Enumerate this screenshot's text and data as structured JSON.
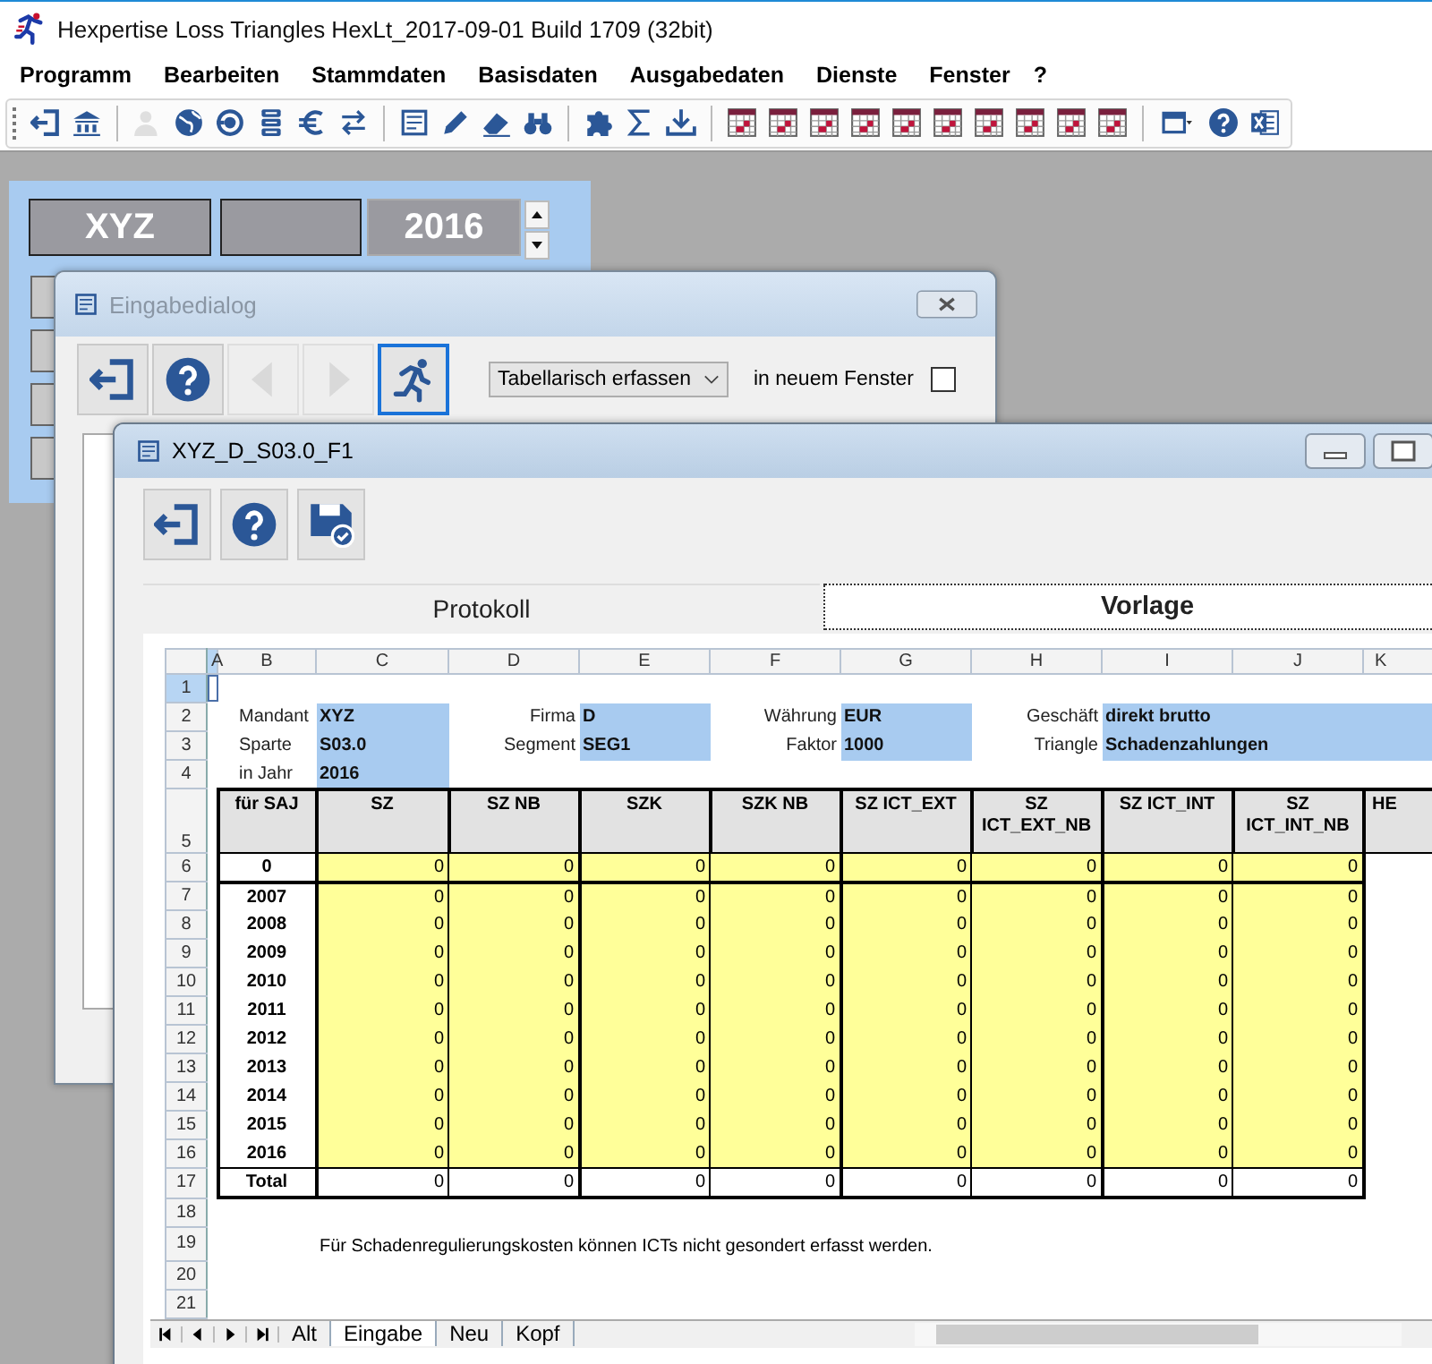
{
  "window": {
    "title": "Hexpertise Loss Triangles HexLt_2017-09-01 Build 1709 (32bit)"
  },
  "menu": [
    "Programm",
    "Bearbeiten",
    "Stammdaten",
    "Basisdaten",
    "Ausgabedaten",
    "Dienste",
    "Fenster",
    "?"
  ],
  "toolbar": [
    {
      "kind": "exit",
      "disabled": false
    },
    {
      "kind": "bank",
      "disabled": false
    },
    {
      "kind": "sep"
    },
    {
      "kind": "user",
      "disabled": true
    },
    {
      "kind": "globe",
      "disabled": false
    },
    {
      "kind": "target",
      "disabled": false
    },
    {
      "kind": "server",
      "disabled": false
    },
    {
      "kind": "euro",
      "disabled": false
    },
    {
      "kind": "exchange",
      "disabled": false
    },
    {
      "kind": "sep"
    },
    {
      "kind": "form",
      "disabled": false
    },
    {
      "kind": "pencil",
      "disabled": false
    },
    {
      "kind": "eraser",
      "disabled": false
    },
    {
      "kind": "binoculars",
      "disabled": false
    },
    {
      "kind": "sep"
    },
    {
      "kind": "puzzle",
      "disabled": false
    },
    {
      "kind": "sigma",
      "disabled": false
    },
    {
      "kind": "download",
      "disabled": false
    },
    {
      "kind": "sep"
    },
    {
      "kind": "grid",
      "disabled": false
    },
    {
      "kind": "grid",
      "disabled": false
    },
    {
      "kind": "grid",
      "disabled": false
    },
    {
      "kind": "grid",
      "disabled": false
    },
    {
      "kind": "grid",
      "disabled": false
    },
    {
      "kind": "grid",
      "disabled": false
    },
    {
      "kind": "grid",
      "disabled": false
    },
    {
      "kind": "grid",
      "disabled": false
    },
    {
      "kind": "grid",
      "disabled": false
    },
    {
      "kind": "grid",
      "disabled": false
    },
    {
      "kind": "sep"
    },
    {
      "kind": "windows",
      "disabled": false
    },
    {
      "kind": "help",
      "disabled": false
    },
    {
      "kind": "excel",
      "disabled": false
    }
  ],
  "panel": {
    "client": "XYZ",
    "year": "2016"
  },
  "dialog": {
    "title": "Eingabedialog",
    "buttons": [
      {
        "kind": "exit",
        "disabled": false,
        "focused": false
      },
      {
        "kind": "help",
        "disabled": false,
        "focused": false
      },
      {
        "kind": "prev",
        "disabled": true,
        "focused": false
      },
      {
        "kind": "next",
        "disabled": true,
        "focused": false
      },
      {
        "kind": "run",
        "disabled": false,
        "focused": true
      }
    ],
    "mode": {
      "value": "Tabellarisch erfassen"
    },
    "new_window": {
      "label": "in neuem Fenster",
      "checked": false
    }
  },
  "sheet_window": {
    "title": "XYZ_D_S03.0_F1",
    "buttons": [
      {
        "kind": "exit"
      },
      {
        "kind": "help"
      },
      {
        "kind": "save"
      }
    ],
    "tabs": [
      {
        "label": "Protokoll",
        "selected": false
      },
      {
        "label": "Vorlage",
        "selected": true
      }
    ],
    "columns": [
      {
        "label": "A",
        "selected": true
      },
      {
        "label": "B",
        "selected": false
      },
      {
        "label": "C",
        "selected": false
      },
      {
        "label": "D",
        "selected": false
      },
      {
        "label": "E",
        "selected": false
      },
      {
        "label": "F",
        "selected": false
      },
      {
        "label": "G",
        "selected": false
      },
      {
        "label": "H",
        "selected": false
      },
      {
        "label": "I",
        "selected": false
      },
      {
        "label": "J",
        "selected": false
      },
      {
        "label": "K",
        "selected": false
      }
    ],
    "rows": [
      {
        "number": "1",
        "kind": "blank",
        "selected": true
      },
      {
        "number": "2",
        "kind": "info",
        "selected": false,
        "pairs": [
          {
            "label": "Mandant",
            "value": "XYZ"
          },
          {
            "label": "Firma",
            "value": "D"
          },
          {
            "label": "Währung",
            "value": "EUR"
          },
          {
            "label": "Geschäft",
            "value": "direkt brutto"
          }
        ]
      },
      {
        "number": "3",
        "kind": "info",
        "selected": false,
        "pairs": [
          {
            "label": "Sparte",
            "value": "S03.0"
          },
          {
            "label": "Segment",
            "value": "SEG1"
          },
          {
            "label": "Faktor",
            "value": "1000"
          },
          {
            "label": "Triangle",
            "value": "Schadenzahlungen"
          }
        ]
      },
      {
        "number": "4",
        "kind": "info",
        "selected": false,
        "pairs": [
          {
            "label": "in Jahr",
            "value": "2016"
          }
        ]
      },
      {
        "number": "5",
        "kind": "header",
        "selected": false,
        "columns": [
          "für SAJ",
          "SZ",
          "SZ NB",
          "SZK",
          "SZK NB",
          "SZ ICT_EXT",
          "SZ\nICT_EXT_NB",
          "SZ ICT_INT",
          "SZ\nICT_INT_NB",
          "HE"
        ]
      },
      {
        "number": "6",
        "kind": "data",
        "selected": false,
        "label": "0",
        "values": [
          "0",
          "0",
          "0",
          "0",
          "0",
          "0",
          "0",
          "0"
        ]
      },
      {
        "number": "7",
        "kind": "data",
        "selected": false,
        "label": "2007",
        "values": [
          "0",
          "0",
          "0",
          "0",
          "0",
          "0",
          "0",
          "0"
        ]
      },
      {
        "number": "8",
        "kind": "data",
        "selected": false,
        "label": "2008",
        "values": [
          "0",
          "0",
          "0",
          "0",
          "0",
          "0",
          "0",
          "0"
        ]
      },
      {
        "number": "9",
        "kind": "data",
        "selected": false,
        "label": "2009",
        "values": [
          "0",
          "0",
          "0",
          "0",
          "0",
          "0",
          "0",
          "0"
        ]
      },
      {
        "number": "10",
        "kind": "data",
        "selected": false,
        "label": "2010",
        "values": [
          "0",
          "0",
          "0",
          "0",
          "0",
          "0",
          "0",
          "0"
        ]
      },
      {
        "number": "11",
        "kind": "data",
        "selected": false,
        "label": "2011",
        "values": [
          "0",
          "0",
          "0",
          "0",
          "0",
          "0",
          "0",
          "0"
        ]
      },
      {
        "number": "12",
        "kind": "data",
        "selected": false,
        "label": "2012",
        "values": [
          "0",
          "0",
          "0",
          "0",
          "0",
          "0",
          "0",
          "0"
        ]
      },
      {
        "number": "13",
        "kind": "data",
        "selected": false,
        "label": "2013",
        "values": [
          "0",
          "0",
          "0",
          "0",
          "0",
          "0",
          "0",
          "0"
        ]
      },
      {
        "number": "14",
        "kind": "data",
        "selected": false,
        "label": "2014",
        "values": [
          "0",
          "0",
          "0",
          "0",
          "0",
          "0",
          "0",
          "0"
        ]
      },
      {
        "number": "15",
        "kind": "data",
        "selected": false,
        "label": "2015",
        "values": [
          "0",
          "0",
          "0",
          "0",
          "0",
          "0",
          "0",
          "0"
        ]
      },
      {
        "number": "16",
        "kind": "data",
        "selected": false,
        "label": "2016",
        "values": [
          "0",
          "0",
          "0",
          "0",
          "0",
          "0",
          "0",
          "0"
        ]
      },
      {
        "number": "17",
        "kind": "total",
        "selected": false,
        "label": "Total",
        "values": [
          "0",
          "0",
          "0",
          "0",
          "0",
          "0",
          "0",
          "0"
        ]
      },
      {
        "number": "18",
        "kind": "blank",
        "selected": false
      },
      {
        "number": "19",
        "kind": "note",
        "selected": false,
        "text": "Für Schadenregulierungskosten können ICTs nicht gesondert erfasst werden."
      },
      {
        "number": "20",
        "kind": "blank",
        "selected": false
      },
      {
        "number": "21",
        "kind": "blank",
        "selected": false
      }
    ],
    "sheet_tabs": [
      {
        "label": "Alt",
        "selected": false
      },
      {
        "label": "Eingabe",
        "selected": true
      },
      {
        "label": "Neu",
        "selected": false
      },
      {
        "label": "Kopf",
        "selected": false
      }
    ]
  }
}
